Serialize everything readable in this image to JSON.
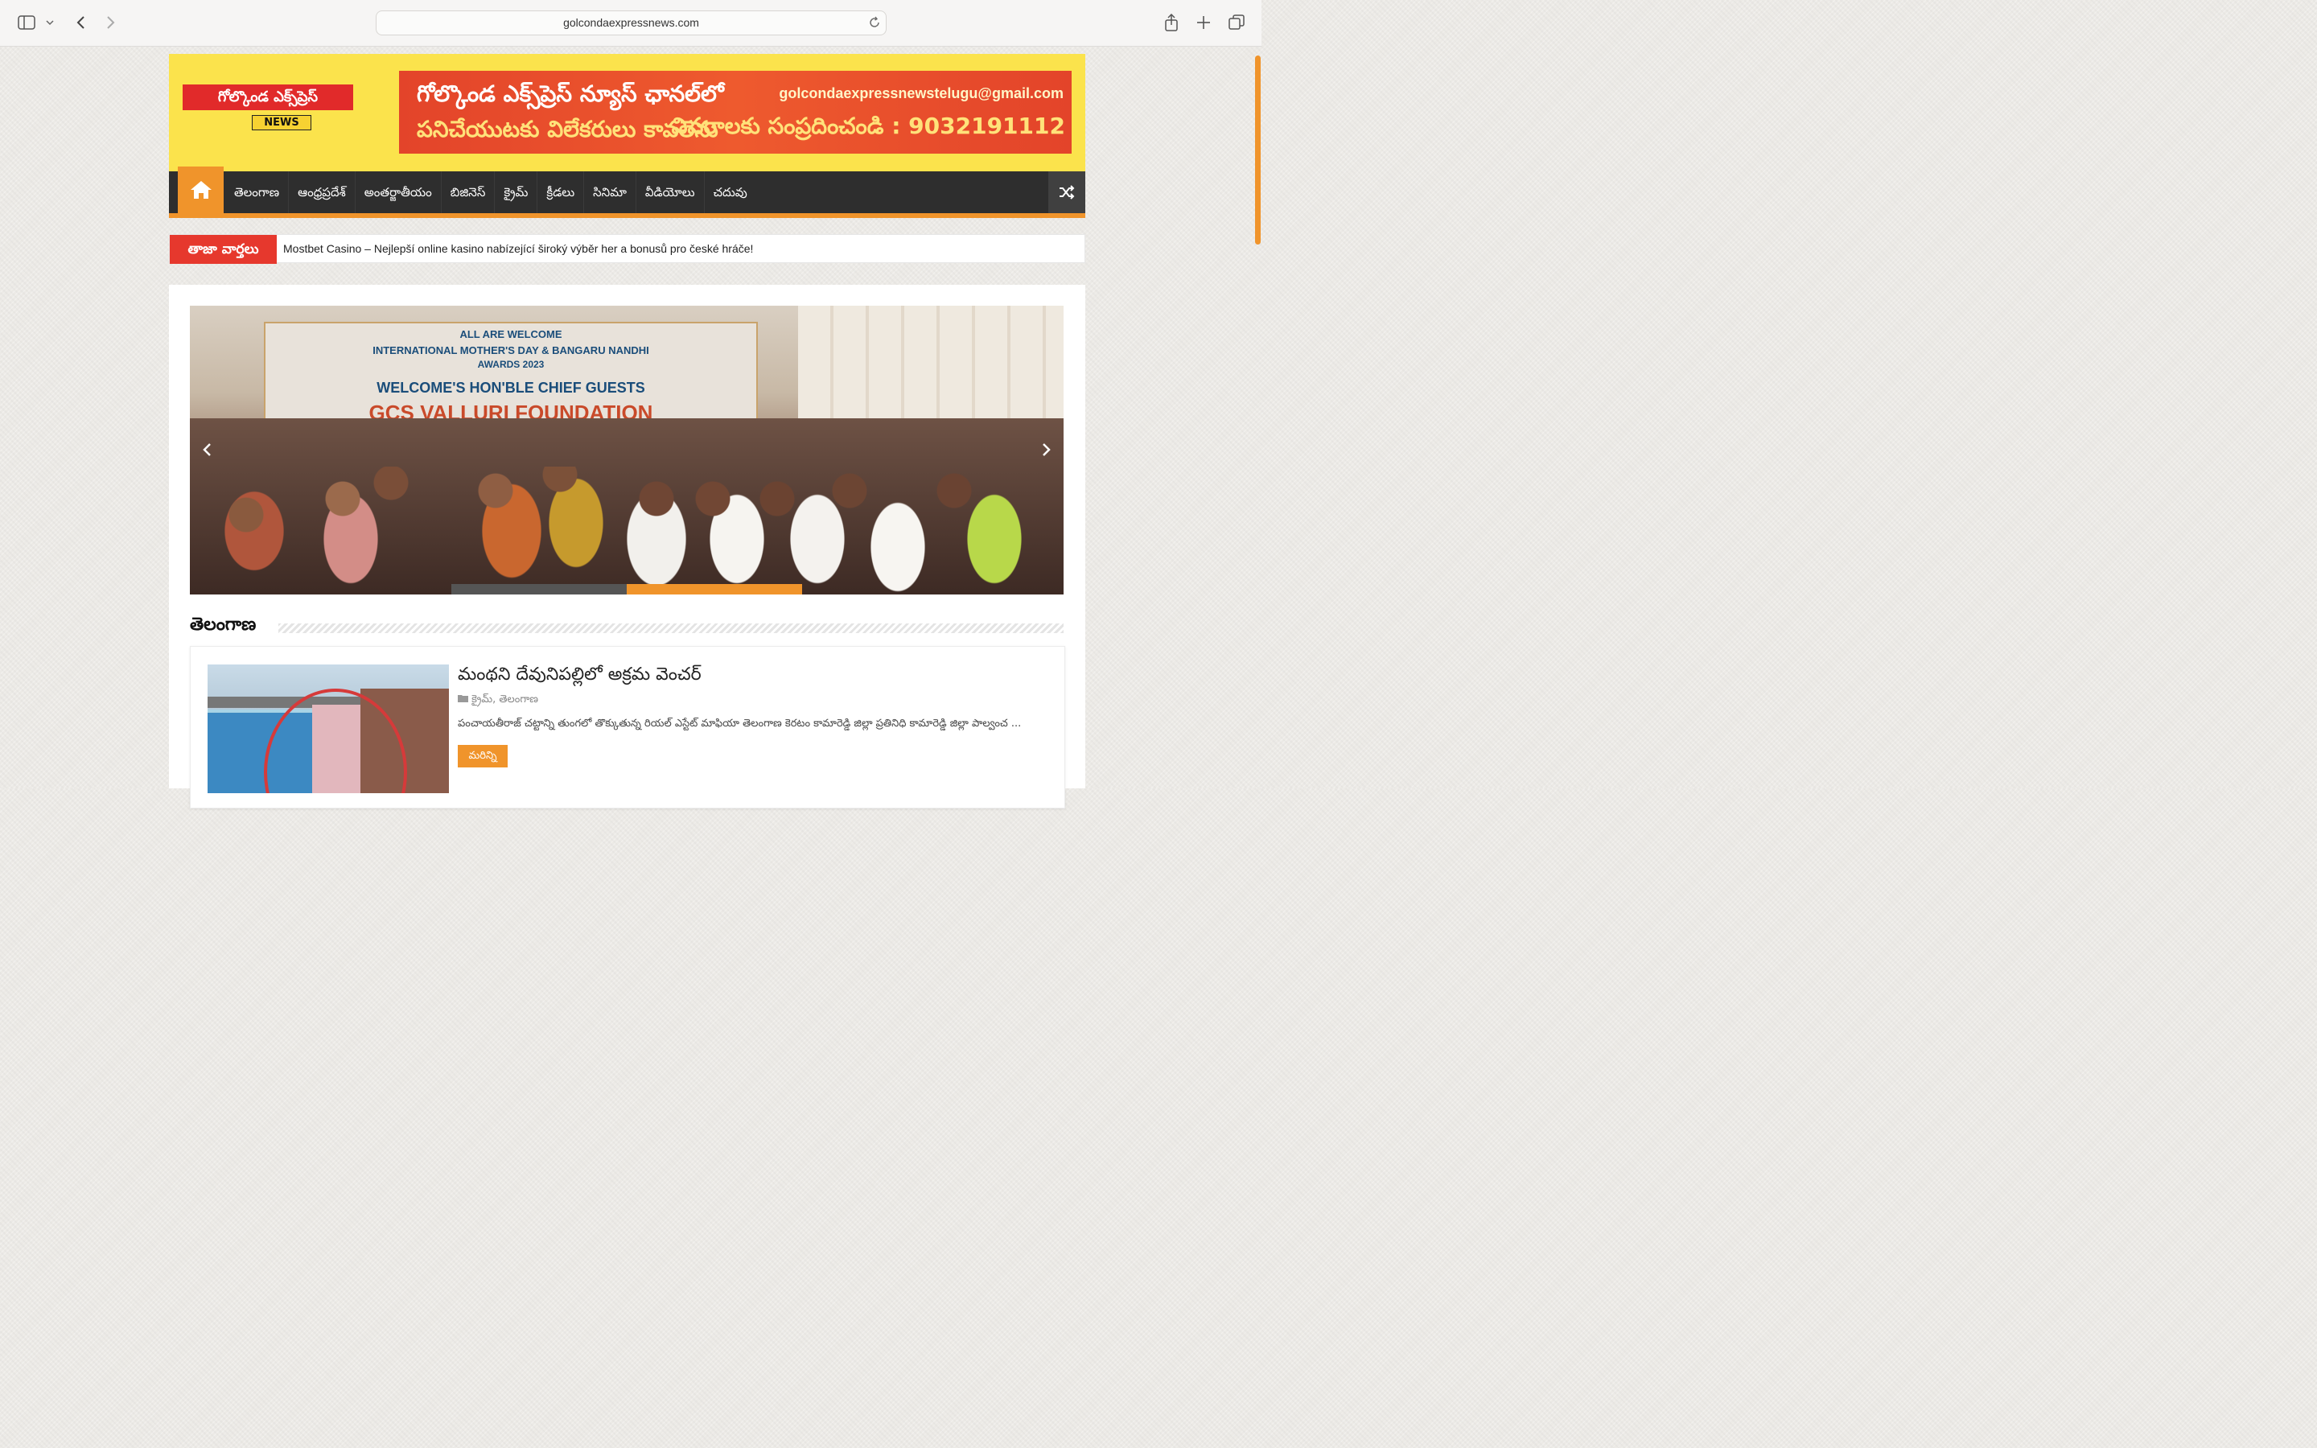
{
  "browser": {
    "url": "golcondaexpressnews.com",
    "icons": [
      "sidebar-icon",
      "chevron-down-icon",
      "back-icon",
      "forward-icon",
      "reload-icon",
      "share-icon",
      "new-tab-icon",
      "tabs-icon"
    ]
  },
  "header": {
    "logo_top": "గోల్కొండ ఎక్స్‌ప్రెస్",
    "logo_news": "NEWS",
    "banner_line1": "గోల్కొండ ఎక్స్‌ప్రెస్ న్యూస్ ఛానల్‌లో",
    "banner_line2": "పనిచేయుటకు విలేకరులు కావలెను",
    "banner_email": "golcondaexpressnewstelugu@gmail.com",
    "banner_phone": "వివరాలకు సంప్రదించండి : 9032191112"
  },
  "nav": {
    "items": [
      "తెలంగాణ",
      "ఆంధ్రప్రదేశ్",
      "అంతర్జాతీయం",
      "బిజినెస్",
      "క్రైమ్",
      "క్రీడలు",
      "సినిమా",
      "వీడియోలు",
      "చదువు"
    ]
  },
  "ticker": {
    "label": "తాజా వార్తలు",
    "headline": "Mostbet Casino – Nejlepší online kasino nabízející široký výběr her a bonusů pro české hráče!"
  },
  "slider": {
    "backdrop": {
      "line1": "ALL ARE WELCOME",
      "line2": "INTERNATIONAL MOTHER'S DAY & BANGARU NANDHI",
      "line3": "AWARDS 2023",
      "line4": "WELCOME'S HON'BLE CHIEF GUESTS",
      "line5": "GCS VALLURI FOUNDATION"
    },
    "active_slide": 2,
    "slide_count": 2
  },
  "section": {
    "title": "తెలంగాణ"
  },
  "post": {
    "title": "మంథని దేవునిపల్లిలో అక్రమ వెంచర్",
    "categories": "క్రైమ్, తెలంగాణ",
    "excerpt": "పంచాయతీరాజ్ చట్టాన్ని తుంగలో తొక్కుతున్న రియల్ ఎస్టేట్ మాఫియా  తెలంగాణ కెరటం కామారెడ్డి జిల్లా ప్రతినిధి కామారెడ్డి జిల్లా పాల్వంచ ...",
    "more_label": "మరిన్ని"
  },
  "colors": {
    "accent": "#f0942b",
    "header_bg": "#fbe34c",
    "nav_bg": "#2e2e2e",
    "ticker_label_bg": "#e6382d"
  }
}
